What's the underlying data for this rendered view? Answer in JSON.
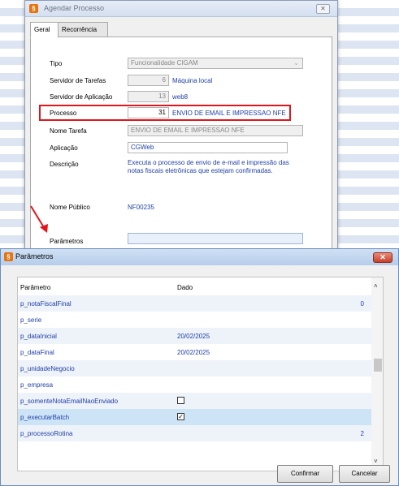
{
  "schedule_window": {
    "title": "Agendar Processo",
    "close_glyph": "⨯",
    "tabs": [
      "Geral",
      "Recorrência"
    ],
    "fields": {
      "tipo_label": "Tipo",
      "tipo_value": "Funcionalidade CIGAM",
      "servidor_tarefas_label": "Servidor de Tarefas",
      "servidor_tarefas_num": "6",
      "servidor_tarefas_desc": "Máquina local",
      "servidor_aplicacao_label": "Servidor de Aplicação",
      "servidor_aplicacao_num": "13",
      "servidor_aplicacao_desc": "web8",
      "processo_label": "Processo",
      "processo_num": "31",
      "processo_desc": "ENVIO DE EMAIL E IMPRESSAO NFE",
      "nome_tarefa_label": "Nome Tarefa",
      "nome_tarefa_value": "ENVIO DE EMAIL E IMPRESSAO NFE",
      "aplicacao_label": "Aplicação",
      "aplicacao_value": "CGWeb",
      "descricao_label": "Descrição",
      "descricao_value": "Executa o processo de envio de e-mail e impressão das notas fiscais eletrônicas que estejam confirmadas.",
      "nome_publico_label": "Nome Público",
      "nome_publico_value": "NF00235",
      "parametros_label": "Parâmetros",
      "parametros_value": ""
    }
  },
  "params_window": {
    "title": "Parâmetros",
    "close_glyph": "✕",
    "columns": [
      "Parâmetro",
      "Dado"
    ],
    "rows": [
      {
        "name": "p_notaFiscalFinal",
        "value": "",
        "right": "0"
      },
      {
        "name": "p_serie",
        "value": "",
        "right": ""
      },
      {
        "name": "p_dataInicial",
        "value": "20/02/2025",
        "right": ""
      },
      {
        "name": "p_dataFinal",
        "value": "20/02/2025",
        "right": ""
      },
      {
        "name": "p_unidadeNegocio",
        "value": "",
        "right": ""
      },
      {
        "name": "p_empresa",
        "value": "",
        "right": ""
      },
      {
        "name": "p_somenteNotaEmailNaoEnviado",
        "value": "",
        "right": "",
        "checkbox": false
      },
      {
        "name": "p_executarBatch",
        "value": "",
        "right": "",
        "checkbox": true
      },
      {
        "name": "p_processoRotina",
        "value": "",
        "right": "2"
      }
    ],
    "confirm_label": "Confirmar",
    "cancel_label": "Cancelar",
    "scroll_up": "˄",
    "scroll_down": "˅",
    "check_mark": "✓"
  },
  "app_icon_glyph": "§"
}
